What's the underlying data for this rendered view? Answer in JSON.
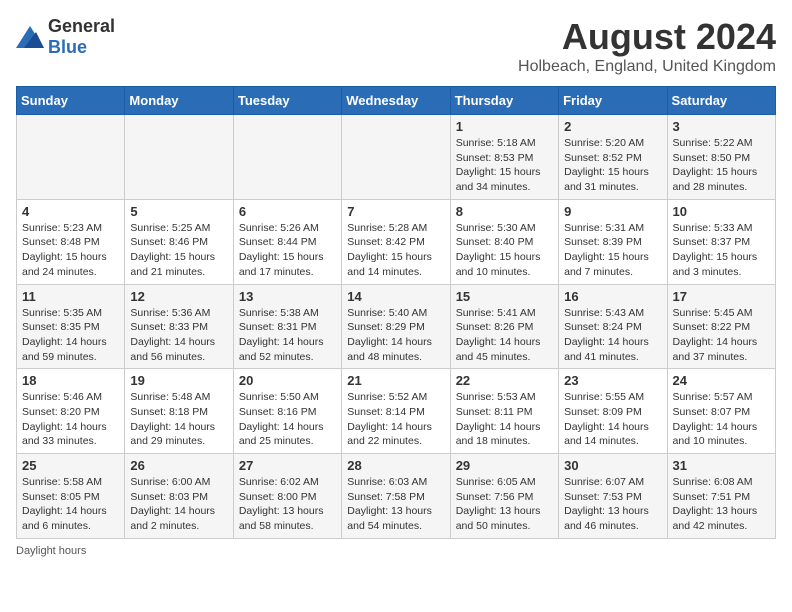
{
  "logo": {
    "general": "General",
    "blue": "Blue"
  },
  "title": "August 2024",
  "subtitle": "Holbeach, England, United Kingdom",
  "footer": "Daylight hours",
  "headers": [
    "Sunday",
    "Monday",
    "Tuesday",
    "Wednesday",
    "Thursday",
    "Friday",
    "Saturday"
  ],
  "weeks": [
    [
      {
        "day": "",
        "content": ""
      },
      {
        "day": "",
        "content": ""
      },
      {
        "day": "",
        "content": ""
      },
      {
        "day": "",
        "content": ""
      },
      {
        "day": "1",
        "content": "Sunrise: 5:18 AM\nSunset: 8:53 PM\nDaylight: 15 hours\nand 34 minutes."
      },
      {
        "day": "2",
        "content": "Sunrise: 5:20 AM\nSunset: 8:52 PM\nDaylight: 15 hours\nand 31 minutes."
      },
      {
        "day": "3",
        "content": "Sunrise: 5:22 AM\nSunset: 8:50 PM\nDaylight: 15 hours\nand 28 minutes."
      }
    ],
    [
      {
        "day": "4",
        "content": "Sunrise: 5:23 AM\nSunset: 8:48 PM\nDaylight: 15 hours\nand 24 minutes."
      },
      {
        "day": "5",
        "content": "Sunrise: 5:25 AM\nSunset: 8:46 PM\nDaylight: 15 hours\nand 21 minutes."
      },
      {
        "day": "6",
        "content": "Sunrise: 5:26 AM\nSunset: 8:44 PM\nDaylight: 15 hours\nand 17 minutes."
      },
      {
        "day": "7",
        "content": "Sunrise: 5:28 AM\nSunset: 8:42 PM\nDaylight: 15 hours\nand 14 minutes."
      },
      {
        "day": "8",
        "content": "Sunrise: 5:30 AM\nSunset: 8:40 PM\nDaylight: 15 hours\nand 10 minutes."
      },
      {
        "day": "9",
        "content": "Sunrise: 5:31 AM\nSunset: 8:39 PM\nDaylight: 15 hours\nand 7 minutes."
      },
      {
        "day": "10",
        "content": "Sunrise: 5:33 AM\nSunset: 8:37 PM\nDaylight: 15 hours\nand 3 minutes."
      }
    ],
    [
      {
        "day": "11",
        "content": "Sunrise: 5:35 AM\nSunset: 8:35 PM\nDaylight: 14 hours\nand 59 minutes."
      },
      {
        "day": "12",
        "content": "Sunrise: 5:36 AM\nSunset: 8:33 PM\nDaylight: 14 hours\nand 56 minutes."
      },
      {
        "day": "13",
        "content": "Sunrise: 5:38 AM\nSunset: 8:31 PM\nDaylight: 14 hours\nand 52 minutes."
      },
      {
        "day": "14",
        "content": "Sunrise: 5:40 AM\nSunset: 8:29 PM\nDaylight: 14 hours\nand 48 minutes."
      },
      {
        "day": "15",
        "content": "Sunrise: 5:41 AM\nSunset: 8:26 PM\nDaylight: 14 hours\nand 45 minutes."
      },
      {
        "day": "16",
        "content": "Sunrise: 5:43 AM\nSunset: 8:24 PM\nDaylight: 14 hours\nand 41 minutes."
      },
      {
        "day": "17",
        "content": "Sunrise: 5:45 AM\nSunset: 8:22 PM\nDaylight: 14 hours\nand 37 minutes."
      }
    ],
    [
      {
        "day": "18",
        "content": "Sunrise: 5:46 AM\nSunset: 8:20 PM\nDaylight: 14 hours\nand 33 minutes."
      },
      {
        "day": "19",
        "content": "Sunrise: 5:48 AM\nSunset: 8:18 PM\nDaylight: 14 hours\nand 29 minutes."
      },
      {
        "day": "20",
        "content": "Sunrise: 5:50 AM\nSunset: 8:16 PM\nDaylight: 14 hours\nand 25 minutes."
      },
      {
        "day": "21",
        "content": "Sunrise: 5:52 AM\nSunset: 8:14 PM\nDaylight: 14 hours\nand 22 minutes."
      },
      {
        "day": "22",
        "content": "Sunrise: 5:53 AM\nSunset: 8:11 PM\nDaylight: 14 hours\nand 18 minutes."
      },
      {
        "day": "23",
        "content": "Sunrise: 5:55 AM\nSunset: 8:09 PM\nDaylight: 14 hours\nand 14 minutes."
      },
      {
        "day": "24",
        "content": "Sunrise: 5:57 AM\nSunset: 8:07 PM\nDaylight: 14 hours\nand 10 minutes."
      }
    ],
    [
      {
        "day": "25",
        "content": "Sunrise: 5:58 AM\nSunset: 8:05 PM\nDaylight: 14 hours\nand 6 minutes."
      },
      {
        "day": "26",
        "content": "Sunrise: 6:00 AM\nSunset: 8:03 PM\nDaylight: 14 hours\nand 2 minutes."
      },
      {
        "day": "27",
        "content": "Sunrise: 6:02 AM\nSunset: 8:00 PM\nDaylight: 13 hours\nand 58 minutes."
      },
      {
        "day": "28",
        "content": "Sunrise: 6:03 AM\nSunset: 7:58 PM\nDaylight: 13 hours\nand 54 minutes."
      },
      {
        "day": "29",
        "content": "Sunrise: 6:05 AM\nSunset: 7:56 PM\nDaylight: 13 hours\nand 50 minutes."
      },
      {
        "day": "30",
        "content": "Sunrise: 6:07 AM\nSunset: 7:53 PM\nDaylight: 13 hours\nand 46 minutes."
      },
      {
        "day": "31",
        "content": "Sunrise: 6:08 AM\nSunset: 7:51 PM\nDaylight: 13 hours\nand 42 minutes."
      }
    ]
  ]
}
